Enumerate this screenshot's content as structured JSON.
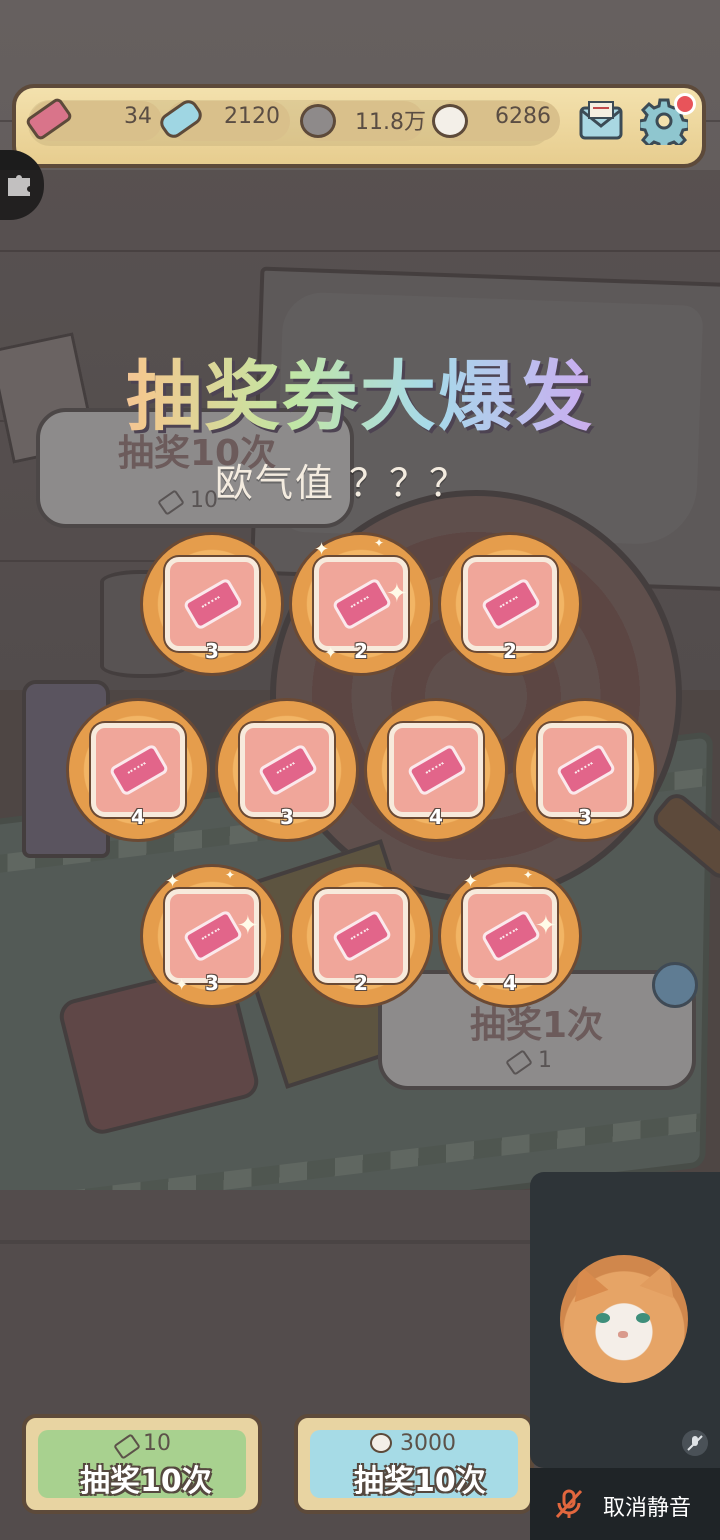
{
  "resources": {
    "tickets": "34",
    "gems": "2120",
    "gray_bubbles": "11.8万",
    "white_bubbles": "6286"
  },
  "icons": {
    "ticket": "ticket-icon",
    "gem": "gem-icon",
    "gray_bubble": "gray-bubble-icon",
    "white_bubble": "white-bubble-icon",
    "mail": "mail-icon",
    "settings": "gear-icon",
    "puzzle": "puzzle-icon"
  },
  "popup": {
    "title": "抽奖券大爆发",
    "luck_label": "欧气值 ？？？",
    "rewards": [
      {
        "count": "3",
        "sparkle": false
      },
      {
        "count": "2",
        "sparkle": true
      },
      {
        "count": "2",
        "sparkle": false
      },
      {
        "count": "4",
        "sparkle": false
      },
      {
        "count": "3",
        "sparkle": false
      },
      {
        "count": "4",
        "sparkle": false
      },
      {
        "count": "3",
        "sparkle": false
      },
      {
        "count": "3",
        "sparkle": true
      },
      {
        "count": "2",
        "sparkle": false
      },
      {
        "count": "4",
        "sparkle": true
      }
    ]
  },
  "under_buttons": {
    "left_label": "抽奖10次",
    "left_cost": "10",
    "right_label": "抽奖1次",
    "right_cost": "1"
  },
  "bottom": {
    "ticket_draw": {
      "cost": "10",
      "label": "抽奖10次",
      "color": "#a8d18f"
    },
    "bubble_draw": {
      "cost": "3000",
      "label": "抽奖10次",
      "color": "#a6dbe6"
    }
  },
  "call": {
    "unmute_label": "取消静音"
  },
  "colors": {
    "bar": "#f3e1ad",
    "ticket": "#e2658a",
    "reward_ring": "#f2b565",
    "card": "#f0a69a"
  }
}
